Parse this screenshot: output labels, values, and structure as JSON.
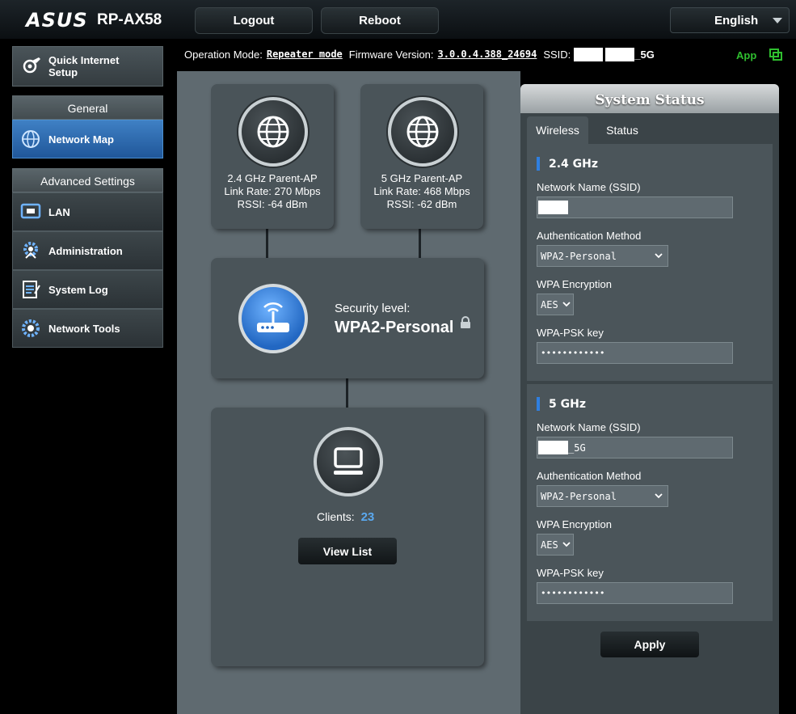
{
  "header": {
    "brand": "ASUS",
    "model": "RP-AX58",
    "logout_label": "Logout",
    "reboot_label": "Reboot",
    "language": "English"
  },
  "info": {
    "op_mode_label": "Operation Mode:",
    "op_mode_value": "Repeater mode",
    "firmware_label": "Firmware Version:",
    "firmware_value": "3.0.0.4.388_24694",
    "ssid_label": "SSID:",
    "ssid_suffix": "_5G",
    "app_label": "App"
  },
  "sidebar": {
    "qis_label_line1": "Quick Internet",
    "qis_label_line2": "Setup",
    "general_header": "General",
    "network_map": "Network Map",
    "advanced_header": "Advanced Settings",
    "items": [
      {
        "label": "LAN"
      },
      {
        "label": "Administration"
      },
      {
        "label": "System Log"
      },
      {
        "label": "Network Tools"
      }
    ]
  },
  "network_map": {
    "ap24": {
      "title": "2.4 GHz Parent-AP",
      "link_rate": "Link Rate: 270 Mbps",
      "rssi": "RSSI: -64 dBm"
    },
    "ap5": {
      "title": "5 GHz Parent-AP",
      "link_rate": "Link Rate: 468 Mbps",
      "rssi": "RSSI: -62 dBm"
    },
    "security_label": "Security level:",
    "security_value": "WPA2-Personal",
    "clients_label": "Clients:",
    "clients_count": "23",
    "view_list_label": "View List"
  },
  "system_status": {
    "title": "System Status",
    "tabs": [
      {
        "label": "Wireless"
      },
      {
        "label": "Status"
      }
    ],
    "band24": {
      "title": "2.4 GHz",
      "ssid_label": "Network Name (SSID)",
      "ssid_value": "",
      "auth_label": "Authentication Method",
      "auth_value": "WPA2-Personal",
      "enc_label": "WPA Encryption",
      "enc_value": "AES",
      "psk_label": "WPA-PSK key",
      "psk_value": "••••••••••••"
    },
    "band5": {
      "title": "5 GHz",
      "ssid_label": "Network Name (SSID)",
      "ssid_value": "_5G",
      "auth_label": "Authentication Method",
      "auth_value": "WPA2-Personal",
      "enc_label": "WPA Encryption",
      "enc_value": "AES",
      "psk_label": "WPA-PSK key",
      "psk_value": "••••••••••••"
    },
    "apply_label": "Apply"
  },
  "colors": {
    "accent_blue": "#2f7fe0",
    "clients_count": "#5aa9f0",
    "app_green": "#2fbf2f",
    "active_nav": "#3f80c4"
  }
}
